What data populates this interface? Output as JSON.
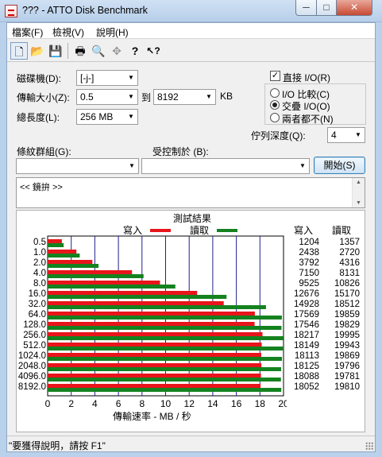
{
  "window": {
    "title": "??? - ATTO Disk Benchmark",
    "min_glyph": "─",
    "max_glyph": "□",
    "close_glyph": "✕"
  },
  "menu": [
    "檔案(F)",
    "檢視(V)",
    "說明(H)"
  ],
  "toolbar": {
    "buttons": [
      {
        "icon": "new-document-icon",
        "glyph": "🗋"
      },
      {
        "icon": "open-folder-icon",
        "glyph": "📂"
      },
      {
        "icon": "save-icon",
        "glyph": "💾"
      },
      {
        "icon": "print-icon",
        "glyph": "🖶"
      },
      {
        "icon": "print-preview-icon",
        "glyph": "🔍"
      },
      {
        "icon": "move-icon",
        "glyph": "✥"
      },
      {
        "icon": "help-icon",
        "glyph": "?"
      },
      {
        "icon": "context-help-icon",
        "glyph": "↖?"
      }
    ]
  },
  "settings": {
    "drive_label": "磁碟機(D):",
    "drive_value": "[-j-]",
    "transfer_label": "傳輸大小(Z):",
    "transfer_from": "0.5",
    "transfer_to_label": "到",
    "transfer_to": "8192",
    "transfer_unit": "KB",
    "length_label": "總長度(L):",
    "length_value": "256 MB",
    "direct_io_label": "直接 I/O(R)",
    "direct_io_checked": true,
    "radio_compare": "I/O 比較(C)",
    "radio_overlap": "交疊 I/O(O)",
    "radio_neither": "兩者都不(N)",
    "queue_label": "佇列深度(Q):",
    "queue_value": "4",
    "pattern_label": "條紋群組(G):",
    "pattern_value": "",
    "controlled_label": "受控制於 (B):",
    "controlled_value": "",
    "start_button": "開始(S)",
    "description": "<< 鏡拚 >>"
  },
  "results": {
    "title": "測試結果",
    "legend_write": "寫入",
    "legend_read": "讀取",
    "col_write": "寫入",
    "col_read": "讀取",
    "xlabel": "傳輸速率 - MB / 秒",
    "colors": {
      "write": "#e8151b",
      "read": "#14821f",
      "grid": "#1f1f8f"
    }
  },
  "chart_data": {
    "type": "bar",
    "orientation": "horizontal",
    "categories": [
      "0.5",
      "1.0",
      "2.0",
      "4.0",
      "8.0",
      "16.0",
      "32.0",
      "64.0",
      "128.0",
      "256.0",
      "512.0",
      "1024.0",
      "2048.0",
      "4096.0",
      "8192.0"
    ],
    "series": [
      {
        "name": "寫入",
        "values": [
          1204,
          2438,
          3792,
          7150,
          9525,
          12676,
          14928,
          17569,
          17546,
          18217,
          18149,
          18113,
          18125,
          18088,
          18052
        ]
      },
      {
        "name": "讀取",
        "values": [
          1357,
          2720,
          4316,
          8131,
          10826,
          15170,
          18512,
          19859,
          19829,
          19995,
          19943,
          19869,
          19796,
          19781,
          19810
        ]
      }
    ],
    "xticks": [
      "0",
      "2",
      "4",
      "6",
      "8",
      "10",
      "12",
      "14",
      "16",
      "18",
      "20"
    ],
    "xlim": [
      0,
      20000
    ],
    "xlabel": "傳輸速率 - MB / 秒",
    "grid": true,
    "legend_position": "top"
  },
  "status": {
    "text": "\"要獲得說明，請按 F1\""
  }
}
